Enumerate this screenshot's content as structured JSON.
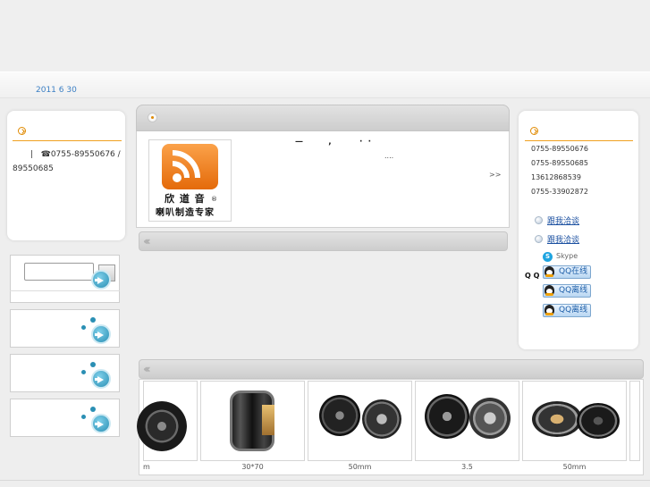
{
  "header": {
    "date": "2011 6 30"
  },
  "left_card": {
    "contact_line1": "|   ☎0755-89550676 /",
    "contact_line2": "89550685"
  },
  "main": {
    "intro_line1": "—         ,          ·  ·",
    "intro_line2": "....",
    "more": ">>",
    "logo_text_line1": "欣 道 音",
    "logo_text_line2": "喇叭制造专家",
    "logo_mark": "®"
  },
  "right_card": {
    "phones": [
      "0755-89550676",
      "0755-89550685",
      "13612868539",
      "0755-33902872"
    ],
    "chat_links": [
      "跟我洽谈",
      "跟我洽谈"
    ],
    "skype_label": "Skype",
    "qq_prefix": "Q Q",
    "qq_buttons": [
      "QQ在线",
      "QQ离线",
      "QQ离线"
    ]
  },
  "products": {
    "labels": [
      "m",
      "30*70",
      "50mm",
      "3.5",
      "50mm"
    ]
  },
  "colors": {
    "accent_orange": "#f0a020",
    "date_blue": "#3b7fc4",
    "link_blue": "#1a4fa0"
  }
}
